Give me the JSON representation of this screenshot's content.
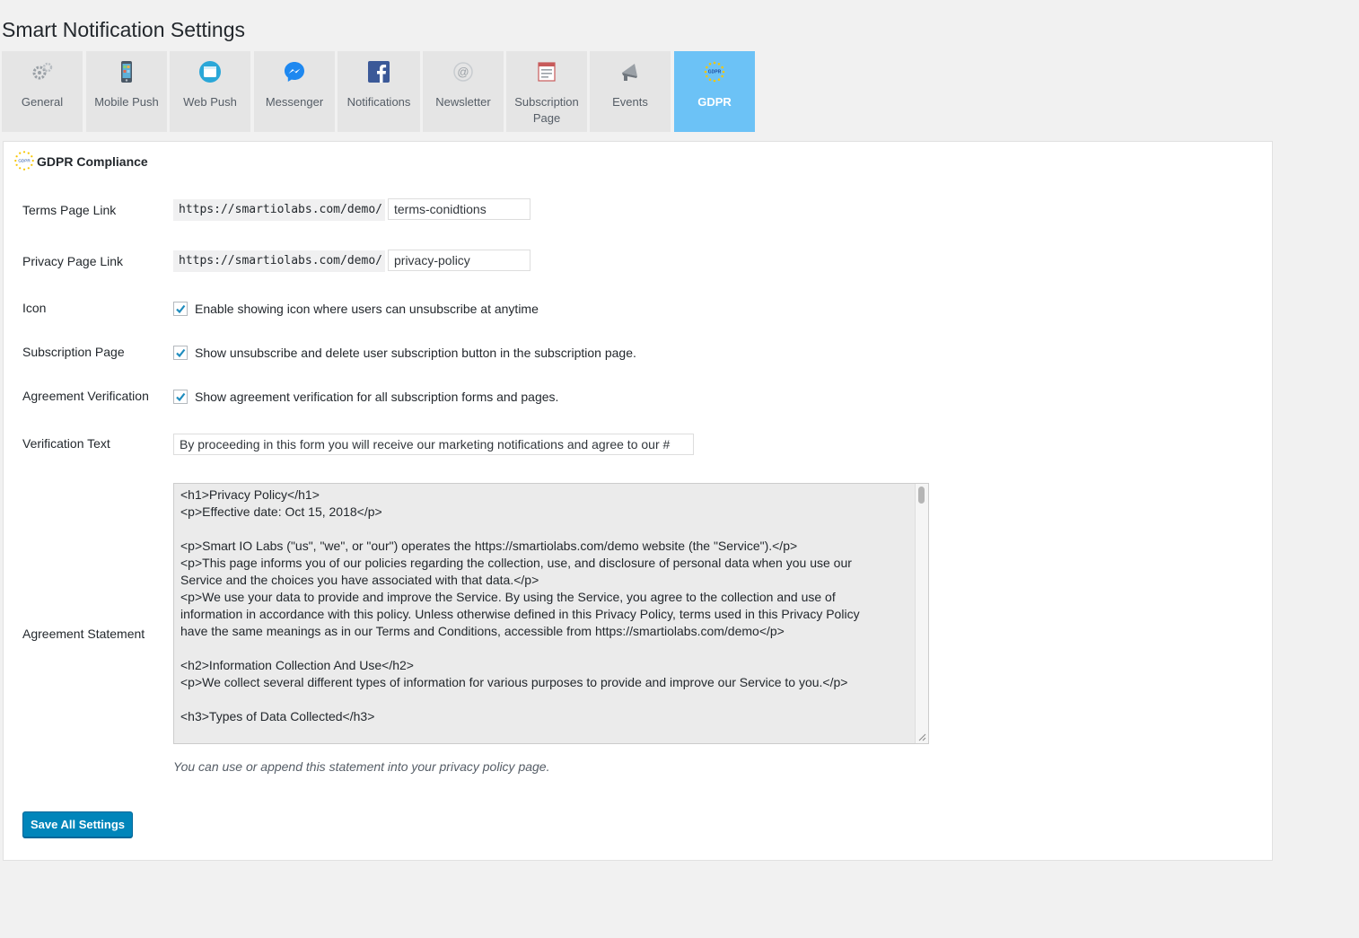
{
  "page": {
    "title": "Smart Notification Settings"
  },
  "tabs": [
    {
      "label": "General",
      "icon": "gears-icon"
    },
    {
      "label": "Mobile Push",
      "icon": "mobile-phone-icon"
    },
    {
      "label": "Web Push",
      "icon": "browser-window-icon"
    },
    {
      "label": "Messenger",
      "icon": "messenger-icon"
    },
    {
      "label": "Notifications",
      "icon": "facebook-icon"
    },
    {
      "label": "Newsletter",
      "icon": "at-sign-icon"
    },
    {
      "label": "Subscription Page",
      "icon": "document-list-icon"
    },
    {
      "label": "Events",
      "icon": "megaphone-icon"
    },
    {
      "label": "GDPR",
      "icon": "gdpr-stars-icon",
      "active": true
    }
  ],
  "section": {
    "title": "GDPR Compliance",
    "icon": "gdpr-stars-icon"
  },
  "terms": {
    "label": "Terms Page Link",
    "prefix": "https://smartiolabs.com/demo/",
    "value": "terms-conidtions"
  },
  "privacy": {
    "label": "Privacy Page Link",
    "prefix": "https://smartiolabs.com/demo/",
    "value": "privacy-policy"
  },
  "icon_opt": {
    "label": "Icon",
    "checkbox_label": "Enable showing icon where users can unsubscribe at anytime",
    "checked": true
  },
  "subpage_opt": {
    "label": "Subscription Page",
    "checkbox_label": "Show unsubscribe and delete user subscription button in the subscription page.",
    "checked": true
  },
  "agree_opt": {
    "label": "Agreement Verification",
    "checkbox_label": "Show agreement verification for all subscription forms and pages.",
    "checked": true
  },
  "verification": {
    "label": "Verification Text",
    "value": "By proceeding in this form you will receive our marketing notifications and agree to our #"
  },
  "statement": {
    "label": "Agreement Statement",
    "lines": [
      "<h1>Privacy Policy</h1>",
      "<p>Effective date: Oct 15, 2018</p>",
      "",
      "<p>Smart IO Labs (\"us\", \"we\", or \"our\") operates the https://smartiolabs.com/demo website (the \"Service\").</p>",
      "<p>This page informs you of our policies regarding the collection, use, and disclosure of personal data when you use our",
      "Service and the choices you have associated with that data.</p>",
      "<p>We use your data to provide and improve the Service. By using the Service, you agree to the collection and use of",
      "information in accordance with this policy. Unless otherwise defined in this Privacy Policy, terms used in this Privacy Policy",
      "have the same meanings as in our Terms and Conditions, accessible from https://smartiolabs.com/demo</p>",
      "",
      "<h2>Information Collection And Use</h2>",
      "<p>We collect several different types of information for various purposes to provide and improve our Service to you.</p>",
      "",
      "<h3>Types of Data Collected</h3>"
    ],
    "hint": "You can use or append this statement into your privacy policy page."
  },
  "save_label": "Save All Settings",
  "colors": {
    "accent": "#0085ba",
    "active_tab": "#6cc2f6",
    "check": "#1e8cbe"
  }
}
